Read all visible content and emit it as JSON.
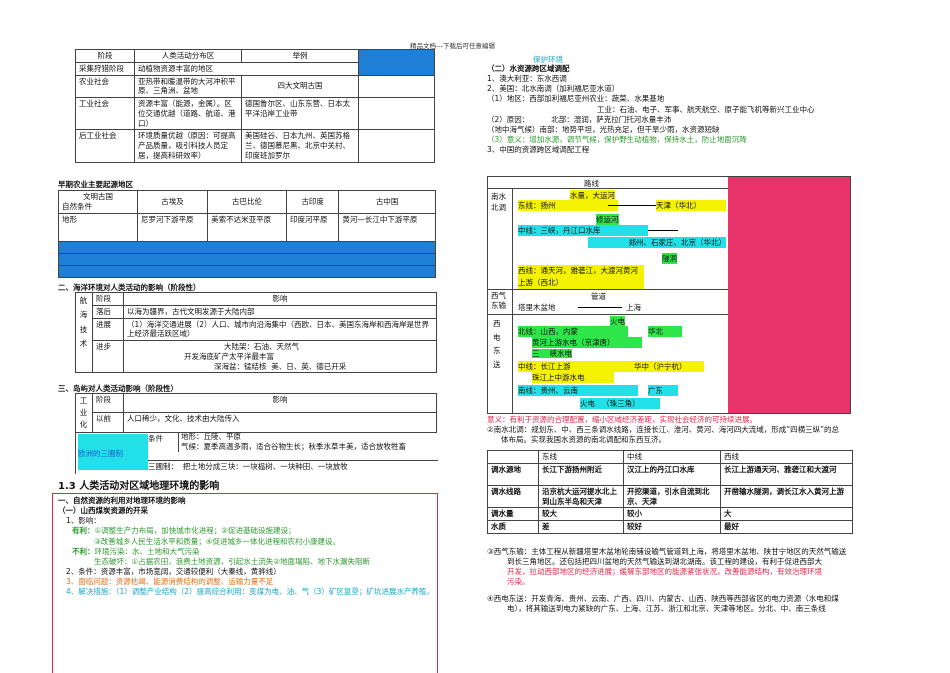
{
  "header": "精品文档---下载后可任意编辑",
  "t1": {
    "head": [
      "阶段",
      "人类活动分布区",
      "举例"
    ],
    "rows": [
      [
        "采集狩猎阶段",
        "动植物资源丰富的地区",
        ""
      ],
      [
        "农业社会",
        "亚热带和暖温带的大河冲积平原、三角洲、盆地",
        "四大文明古国"
      ],
      [
        "工业社会",
        "资源丰富（能源，金属）。区位交通优越（道路、航道、港口）",
        "德国鲁尔区、山东东营、日本太平洋沿岸工业带"
      ],
      [
        "后工业社会",
        "环境质量优越（原因：可提高产品质量，吸引科技人员定居，提高科研效率）",
        "美国硅谷、日本九州、英国苏格兰、德国慕尼黑、北京中关村、印度班加罗尔"
      ]
    ]
  },
  "t2": {
    "title": "早期农业主要起源地区",
    "corner_top": "文明古国",
    "corner_bottom": "自然条件",
    "head": [
      "古埃及",
      "古巴比伦",
      "古印度",
      "古中国"
    ],
    "row_label": "地形",
    "row": [
      "尼罗河下游平原",
      "美索不达米亚平原",
      "印度河平原",
      "黄河—长江中下游平原"
    ]
  },
  "sec2": {
    "title": "二、海洋环境对人类活动的影响（阶段性）",
    "vlabel": "航海技术",
    "head": [
      "阶段",
      "影响"
    ],
    "rows": [
      [
        "落后",
        "以海为疆界，古代文明发源于大陆内部"
      ],
      [
        "进展",
        "（1）海洋交通进展（2）人口、城市向沿海集中（西欧、日本、美国东海岸和西海岸是世界上经济最活跃区域）"
      ]
    ],
    "jinbu": "进步",
    "jinbu_lines": [
      "大陆架：石油、天然气",
      "开发海底矿产太平洋最丰富",
      "深海盆：锰结核",
      "美、日、英、德已开采"
    ]
  },
  "sec3": {
    "title": "三、岛屿对人类活动影响（阶段性）",
    "vlabel": "工业化",
    "head": [
      "阶段",
      "影响"
    ],
    "row": [
      "以前",
      "人口稀少，文化、技术由大陆传入"
    ],
    "eu": "欧洲的三圃制",
    "cond_label": "条件",
    "cond": [
      "地形：丘陵、平原",
      "气候：夏季高温多雨，适合谷物生长；秋季水草丰美，适合放牧牲畜"
    ],
    "system_label": "三圃制：",
    "system": "把土地分成三块：一块榀树、一块种田、一块放牧"
  },
  "sec13": {
    "title": "1.3 人类活动对区域地理环境的影响",
    "sub": "一、自然资源的利用对地理环境的影响",
    "sub2": "（一）山西煤炭资源的开采",
    "impact": "1、影响：",
    "good_label": "有利：",
    "good1": "①调整生产力布局，加快城市化进程；②促进基础设施建设；",
    "good2": "③改善城乡人民生活水平和质量；④促进城乡一体化进程和农村小康建设。",
    "bad_label": "不利：",
    "bad1": "环境污染：水、土地和大气污染",
    "bad2": "生态破坏：①占据农田，浪费土地资源，引起水土流失②地面塌陷、地下水漏失阻断",
    "item2": "2、条件：资源丰富，市场宽阔，交通较便利（大秦线，黄骅线）",
    "item3": "3、面临问题：资源枯竭、能源消费结构的调整、运输力量不足",
    "item4": "4、解决措施：（1）调整产业结构（2）提高综合利用：变煤为电、油、气（3）矿区复垦；矿坑进展水产养殖，"
  },
  "right": {
    "protect": "保护环境",
    "sec_title": "（二）水资源跨区域调配",
    "r1": "1、澳大利亚：东水西调",
    "r2": "2、美国：北水南调（加利福尼亚水道）",
    "r3": "（1）地区：西部加利福尼亚州农业：蔬菜、水果基地",
    "r3b": "工业：石油、电子、军事、航天航空、原子能飞机等新兴工业中心",
    "r4": "（2）原因：",
    "r4a": "北部：湿润，萨克拉门托河水量丰沛",
    "r4b_pre": "（地中海气候）",
    "r4b": "南部：地势平坦，光热充足，但干旱少雨，水资源短缺",
    "r5": "（3）意义：增加水源，调节气候，保护野生动植物，保持水土，防止地面沉降",
    "r6": "3、中国的资源跨区域调配工程",
    "route_head": "路线",
    "nbd_label": "南水北调",
    "east_tag": "水量，大运河",
    "east": "东线：扬州",
    "east_end": "天津（华北）",
    "mid_tag": "修运河",
    "mid": "中线：三峡，丹江口水库",
    "mid_end": "郑州、石家庄、北京（华北）",
    "west_tag": "隧洞",
    "west": "西线：通天河，雅砻江，大渡河黄河上游（西北）",
    "xqd_label": "西气东输",
    "pipe": "管道",
    "xqd": "塔里木盆地",
    "xqd_end": "上海",
    "xdd_label": "西电东送",
    "n_tag": "火电",
    "north": "北线：山西，内蒙",
    "north_end": "华北",
    "north2": "黄河上游水电（京津唐）",
    "north3a": "三",
    "north3b": "峡水电",
    "middle": "中线：长江上游",
    "middle_end": "华中（沪宁杭）",
    "middle2": "珠江上中游水电",
    "south": "南线：贵州、云南",
    "south_end": "广东",
    "south2a": "火电",
    "south2b": "（珠三角）",
    "sig": "意义：有利于资源的合理配置，缩小区域经济差距，实现社会经济的可持续进展。",
    "nbd_p1": "②南水北调：规划东、中、西三条调水线路，连接长江、淮河、黄河、海河四大流域，形成“四横三纵”的总",
    "nbd_p2": "体布局。实现我国水资源的南北调配和东西互济。",
    "t3": {
      "head": [
        "",
        "东线",
        "中线",
        "西线"
      ],
      "rows": [
        [
          "调水源地",
          "长江下游扬州附近",
          "汉江上的丹江口水库",
          "长江上游通天河、雅砻江和大渡河"
        ],
        [
          "调水线路",
          "沿京杭大运河提水北上到山东半岛和天津",
          "开挖渠道，引水自流到北京、天津",
          "开凿输水隧洞，调长江水入黄河上游"
        ],
        [
          "调水量",
          "较大",
          "较小",
          "大"
        ],
        [
          "水质",
          "差",
          "较好",
          "最好"
        ]
      ]
    },
    "xq1": "③西气东输：主体工程从新疆塔里木盆地轮南铺设输气管道到上海，将塔里木盆地、陕甘宁地区的天然气输送",
    "xq2": "到长三角地区。还包括把四川盆地的天然气输送到湖北湖南。该工程的建设，有利于促进西部大",
    "xq3": "开发，拉动西部地区的经济进展；缓解东部地区的能源紧张状况，改善能源结构，有效治理环境",
    "xq4": "污染。",
    "xd1": "④西电东送：开发青海、贵州、云南、广西、四川、内蒙古、山西、陕西等西部省区的电力资源（水电和煤",
    "xd2": "电），将其输送到电力紧缺的广东、上海、江苏、浙江和北京、天津等地区。分北、中、南三条线"
  }
}
